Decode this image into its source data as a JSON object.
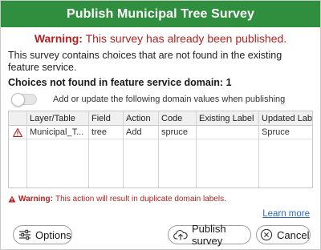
{
  "dialog": {
    "title": "Publish Municipal Tree Survey"
  },
  "header_warning": {
    "prefix": "Warning:",
    "text": " This survey has already been published."
  },
  "description": "This survey contains choices that are not found in the existing feature service.",
  "choices_count": "Choices not found in feature service domain: 1",
  "toggle": {
    "label": "Add or update the following domain values when publishing",
    "checked": false
  },
  "table": {
    "columns": [
      "",
      "Layer/Table",
      "Field",
      "Action",
      "Code",
      "Existing Label",
      "Updated Label"
    ],
    "rows": [
      [
        "warning-icon",
        "Municipal_T...",
        "tree",
        "Add",
        "spruce",
        "",
        "Spruce"
      ]
    ]
  },
  "bottom_warning": {
    "prefix": "Warning:",
    "text": "This action will result in duplicate domain labels."
  },
  "learn_more": "Learn more",
  "buttons": {
    "options": "Options",
    "publish": "Publish survey",
    "cancel": "Cancel"
  },
  "colors": {
    "titlebar": "#2f8f3e",
    "warning": "#b22222",
    "link": "#2b6bb3"
  }
}
